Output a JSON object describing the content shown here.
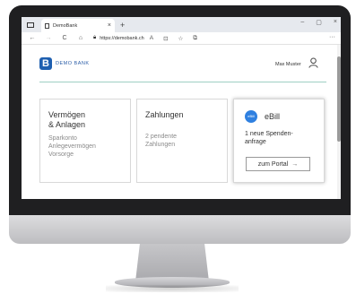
{
  "browser": {
    "tab_title": "DemoBank",
    "tab_close": "×",
    "new_tab": "+",
    "window_controls": {
      "minimize": "–",
      "restore": "▢",
      "close": "×"
    },
    "nav": {
      "back": "←",
      "forward": "→",
      "reload": "C",
      "home": "⌂"
    },
    "url": "https://demobank.ch",
    "toolbar_icons": [
      "read-aloud-icon",
      "tab-actions-icon",
      "favorites-icon",
      "collections-icon"
    ],
    "menu": "···"
  },
  "site": {
    "brand_logo_letter": "B",
    "brand_name": "DEMO BANK",
    "user_name": "Max Muster",
    "accent_color": "#1e5fb0",
    "divider_color": "#9fd0c3"
  },
  "cards": [
    {
      "title_line1": "Vermögen",
      "title_line2": "& Anlagen",
      "items": [
        "Sparkonto",
        "Anlegevermögen",
        "Vorsorge"
      ]
    },
    {
      "title": "Zahlungen",
      "detail_line1": "2 pendente",
      "detail_line2": "Zahlungen"
    },
    {
      "badge": "eBill",
      "title": "eBill",
      "detail_line1": "1 neue Spenden-",
      "detail_line2": "anfrage",
      "button_label": "zum Portal",
      "button_icon": "arrow-right-icon"
    }
  ]
}
